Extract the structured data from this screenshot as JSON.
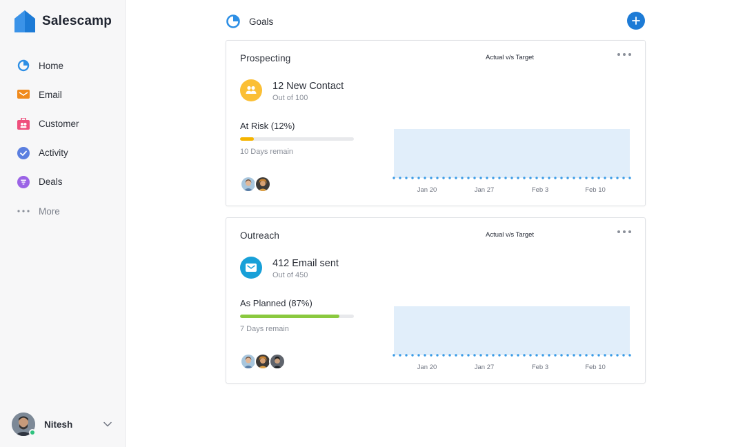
{
  "app": {
    "name": "Salescamp"
  },
  "sidebar": {
    "items": [
      {
        "label": "Home",
        "icon": "home-pie-icon"
      },
      {
        "label": "Email",
        "icon": "mail-icon"
      },
      {
        "label": "Customer",
        "icon": "customer-icon"
      },
      {
        "label": "Activity",
        "icon": "activity-check-icon"
      },
      {
        "label": "Deals",
        "icon": "deals-filter-icon"
      },
      {
        "label": "More",
        "icon": "more-dots-icon"
      }
    ],
    "user": {
      "name": "Nitesh"
    }
  },
  "page": {
    "title": "Goals"
  },
  "colors": {
    "accent": "#1d7bd6",
    "risk": "#f5b400",
    "planned": "#8ac93f",
    "chart_area": "#e1eefa",
    "chart_dots": "#3a9be6"
  },
  "goals": [
    {
      "title": "Prospecting",
      "legend": "Actual v/s Target",
      "metric": "12 New Contact",
      "sub": "Out of 100",
      "status": "At Risk  (12%)",
      "progress": 0.12,
      "remain": "10 Days remain",
      "icon": "users-icon",
      "icon_color": "#fbbf35",
      "bar_color": "#f5b400",
      "chart_data": {
        "type": "area",
        "x": [
          "Jan 20",
          "Jan 27",
          "Feb 3",
          "Feb 10"
        ],
        "title": "",
        "xlabel": "",
        "ylabel": ""
      }
    },
    {
      "title": "Outreach",
      "legend": "Actual v/s Target",
      "metric": "412 Email sent",
      "sub": "Out of 450",
      "status": "As Planned  (87%)",
      "progress": 0.87,
      "remain": "7 Days remain",
      "icon": "envelope-icon",
      "icon_color": "#18a0d8",
      "bar_color": "#8ac93f",
      "chart_data": {
        "type": "area",
        "x": [
          "Jan 20",
          "Jan 27",
          "Feb 3",
          "Feb 10"
        ],
        "title": "",
        "xlabel": "",
        "ylabel": ""
      }
    }
  ]
}
